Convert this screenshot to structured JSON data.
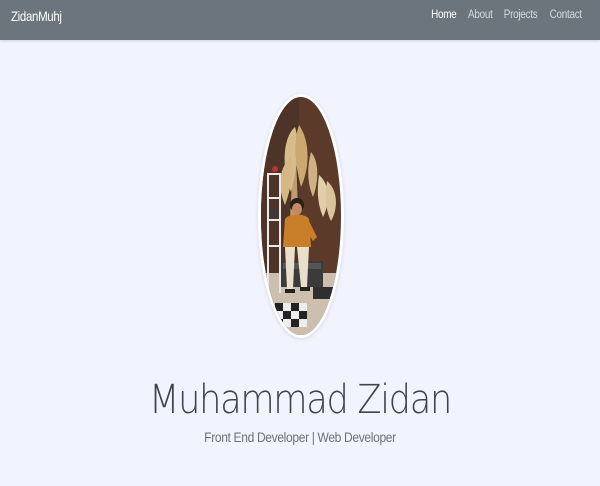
{
  "navbar": {
    "brand": "ZidanMuhj",
    "links": [
      {
        "label": "Home",
        "active": true
      },
      {
        "label": "About",
        "active": false
      },
      {
        "label": "Projects",
        "active": false
      },
      {
        "label": "Contact",
        "active": false
      }
    ]
  },
  "hero": {
    "name": "Muhammad Zidan",
    "subtitle": "Front End Developer | Web Developer"
  },
  "colors": {
    "navbar_bg": "#6c757d",
    "page_bg": "#f1f4fe",
    "name_text": "#3f4449",
    "subtitle_text": "#6d7276"
  }
}
